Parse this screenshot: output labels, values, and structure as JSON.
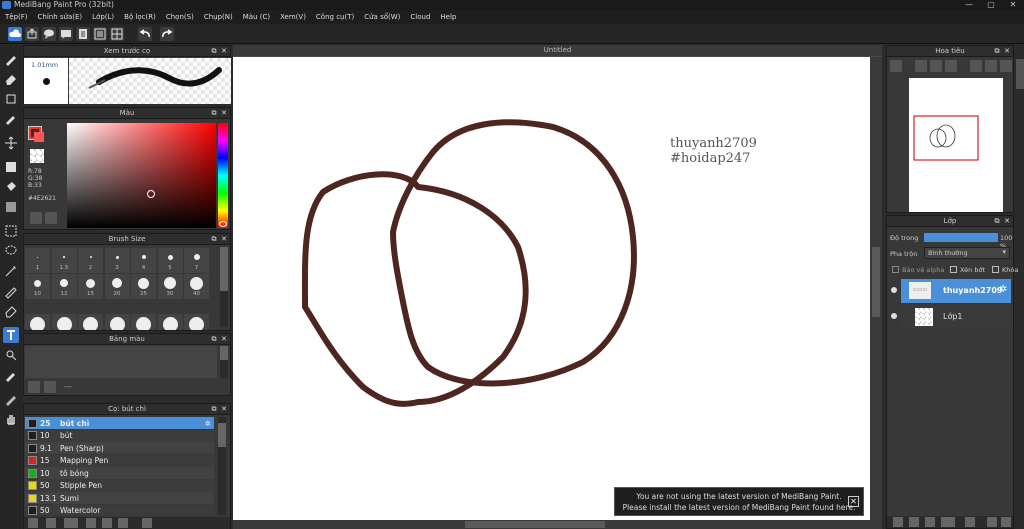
{
  "window": {
    "title": "MediBang Paint Pro (32bit)"
  },
  "menu": [
    "Tệp(F)",
    "Chỉnh sửa(E)",
    "Lớp(L)",
    "Bộ lọc(R)",
    "Chọn(S)",
    "Chụp(N)",
    "Màu (C)",
    "Xem(V)",
    "Công cụ(T)",
    "Cửa sổ(W)",
    "Cloud",
    "Help"
  ],
  "brush_preview": {
    "title": "Xem trước cọ",
    "size": "1.01mm"
  },
  "color_panel": {
    "title": "Màu",
    "r": "R:78",
    "g": "G:38",
    "b": "B:33",
    "hex": "#4E2621",
    "current": "#4E2621"
  },
  "brush_size": {
    "title": "Brush Size",
    "row1": [
      "1",
      "1.5",
      "2",
      "3",
      "4",
      "5",
      "7"
    ],
    "row2": [
      "10",
      "12",
      "15",
      "20",
      "25",
      "30",
      "40"
    ]
  },
  "palette_panel": {
    "title": "Bảng màu",
    "dash": "---"
  },
  "brush_panel": {
    "title": "Cọ: bút chì",
    "items": [
      {
        "size": "25",
        "name": "bút chì",
        "color": "#1e1e1e",
        "selected": true
      },
      {
        "size": "10",
        "name": "bút",
        "color": "#1e1e1e",
        "selected": false
      },
      {
        "size": "9.1",
        "name": "Pen (Sharp)",
        "color": "#1e1e1e",
        "selected": false
      },
      {
        "size": "15",
        "name": "Mapping Pen",
        "color": "#e02020",
        "selected": false
      },
      {
        "size": "10",
        "name": "tô bóng",
        "color": "#18b018",
        "selected": false
      },
      {
        "size": "50",
        "name": "Stipple Pen",
        "color": "#e8d810",
        "selected": false
      },
      {
        "size": "13.1",
        "name": "Sumi",
        "color": "#e8d810",
        "selected": false
      },
      {
        "size": "50",
        "name": "Watercolor",
        "color": "#1e1e1e",
        "selected": false
      }
    ]
  },
  "canvas": {
    "tab": "Untitled",
    "text_line1": "thuyanh2709",
    "text_line2": "#hoidap247",
    "stroke_color": "#4E2621"
  },
  "navigator": {
    "title": "Hoa tiêu"
  },
  "layer_panel": {
    "title": "Lớp",
    "opacity_label": "Độ trong",
    "opacity_value": "100 %",
    "opacity_fraction": 1.0,
    "blend_label": "Pha trộn",
    "blend_value": "Bình thường",
    "protect_alpha": "Bảo vệ alpha",
    "clip": "Xén bớt",
    "lock": "Khóa",
    "layers": [
      {
        "name": "thuyanh2709",
        "selected": true
      },
      {
        "name": "Lớp1",
        "selected": false
      }
    ]
  },
  "notice": {
    "line1": "You are not using the latest version of MediBang Paint.",
    "line2": "Please install the latest version of MediBang Paint found here."
  }
}
